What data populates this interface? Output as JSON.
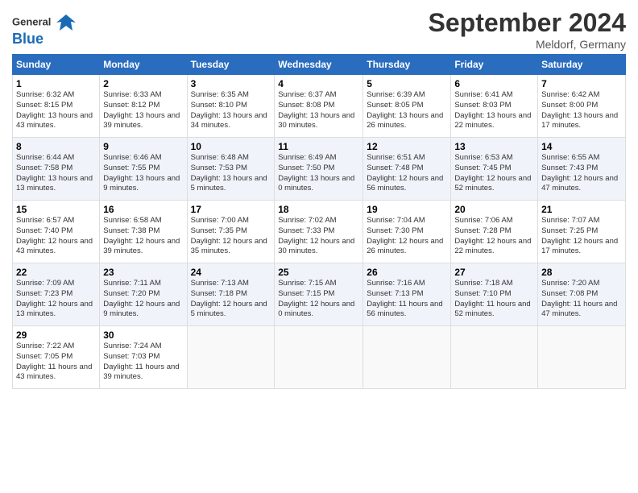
{
  "header": {
    "month_title": "September 2024",
    "location": "Meldorf, Germany",
    "logo_general": "General",
    "logo_blue": "Blue"
  },
  "days_of_week": [
    "Sunday",
    "Monday",
    "Tuesday",
    "Wednesday",
    "Thursday",
    "Friday",
    "Saturday"
  ],
  "weeks": [
    [
      {
        "day": "1",
        "sunrise": "6:32 AM",
        "sunset": "8:15 PM",
        "daylight": "13 hours and 43 minutes."
      },
      {
        "day": "2",
        "sunrise": "6:33 AM",
        "sunset": "8:12 PM",
        "daylight": "13 hours and 39 minutes."
      },
      {
        "day": "3",
        "sunrise": "6:35 AM",
        "sunset": "8:10 PM",
        "daylight": "13 hours and 34 minutes."
      },
      {
        "day": "4",
        "sunrise": "6:37 AM",
        "sunset": "8:08 PM",
        "daylight": "13 hours and 30 minutes."
      },
      {
        "day": "5",
        "sunrise": "6:39 AM",
        "sunset": "8:05 PM",
        "daylight": "13 hours and 26 minutes."
      },
      {
        "day": "6",
        "sunrise": "6:41 AM",
        "sunset": "8:03 PM",
        "daylight": "13 hours and 22 minutes."
      },
      {
        "day": "7",
        "sunrise": "6:42 AM",
        "sunset": "8:00 PM",
        "daylight": "13 hours and 17 minutes."
      }
    ],
    [
      {
        "day": "8",
        "sunrise": "6:44 AM",
        "sunset": "7:58 PM",
        "daylight": "13 hours and 13 minutes."
      },
      {
        "day": "9",
        "sunrise": "6:46 AM",
        "sunset": "7:55 PM",
        "daylight": "13 hours and 9 minutes."
      },
      {
        "day": "10",
        "sunrise": "6:48 AM",
        "sunset": "7:53 PM",
        "daylight": "13 hours and 5 minutes."
      },
      {
        "day": "11",
        "sunrise": "6:49 AM",
        "sunset": "7:50 PM",
        "daylight": "13 hours and 0 minutes."
      },
      {
        "day": "12",
        "sunrise": "6:51 AM",
        "sunset": "7:48 PM",
        "daylight": "12 hours and 56 minutes."
      },
      {
        "day": "13",
        "sunrise": "6:53 AM",
        "sunset": "7:45 PM",
        "daylight": "12 hours and 52 minutes."
      },
      {
        "day": "14",
        "sunrise": "6:55 AM",
        "sunset": "7:43 PM",
        "daylight": "12 hours and 47 minutes."
      }
    ],
    [
      {
        "day": "15",
        "sunrise": "6:57 AM",
        "sunset": "7:40 PM",
        "daylight": "12 hours and 43 minutes."
      },
      {
        "day": "16",
        "sunrise": "6:58 AM",
        "sunset": "7:38 PM",
        "daylight": "12 hours and 39 minutes."
      },
      {
        "day": "17",
        "sunrise": "7:00 AM",
        "sunset": "7:35 PM",
        "daylight": "12 hours and 35 minutes."
      },
      {
        "day": "18",
        "sunrise": "7:02 AM",
        "sunset": "7:33 PM",
        "daylight": "12 hours and 30 minutes."
      },
      {
        "day": "19",
        "sunrise": "7:04 AM",
        "sunset": "7:30 PM",
        "daylight": "12 hours and 26 minutes."
      },
      {
        "day": "20",
        "sunrise": "7:06 AM",
        "sunset": "7:28 PM",
        "daylight": "12 hours and 22 minutes."
      },
      {
        "day": "21",
        "sunrise": "7:07 AM",
        "sunset": "7:25 PM",
        "daylight": "12 hours and 17 minutes."
      }
    ],
    [
      {
        "day": "22",
        "sunrise": "7:09 AM",
        "sunset": "7:23 PM",
        "daylight": "12 hours and 13 minutes."
      },
      {
        "day": "23",
        "sunrise": "7:11 AM",
        "sunset": "7:20 PM",
        "daylight": "12 hours and 9 minutes."
      },
      {
        "day": "24",
        "sunrise": "7:13 AM",
        "sunset": "7:18 PM",
        "daylight": "12 hours and 5 minutes."
      },
      {
        "day": "25",
        "sunrise": "7:15 AM",
        "sunset": "7:15 PM",
        "daylight": "12 hours and 0 minutes."
      },
      {
        "day": "26",
        "sunrise": "7:16 AM",
        "sunset": "7:13 PM",
        "daylight": "11 hours and 56 minutes."
      },
      {
        "day": "27",
        "sunrise": "7:18 AM",
        "sunset": "7:10 PM",
        "daylight": "11 hours and 52 minutes."
      },
      {
        "day": "28",
        "sunrise": "7:20 AM",
        "sunset": "7:08 PM",
        "daylight": "11 hours and 47 minutes."
      }
    ],
    [
      {
        "day": "29",
        "sunrise": "7:22 AM",
        "sunset": "7:05 PM",
        "daylight": "11 hours and 43 minutes."
      },
      {
        "day": "30",
        "sunrise": "7:24 AM",
        "sunset": "7:03 PM",
        "daylight": "11 hours and 39 minutes."
      },
      null,
      null,
      null,
      null,
      null
    ]
  ]
}
